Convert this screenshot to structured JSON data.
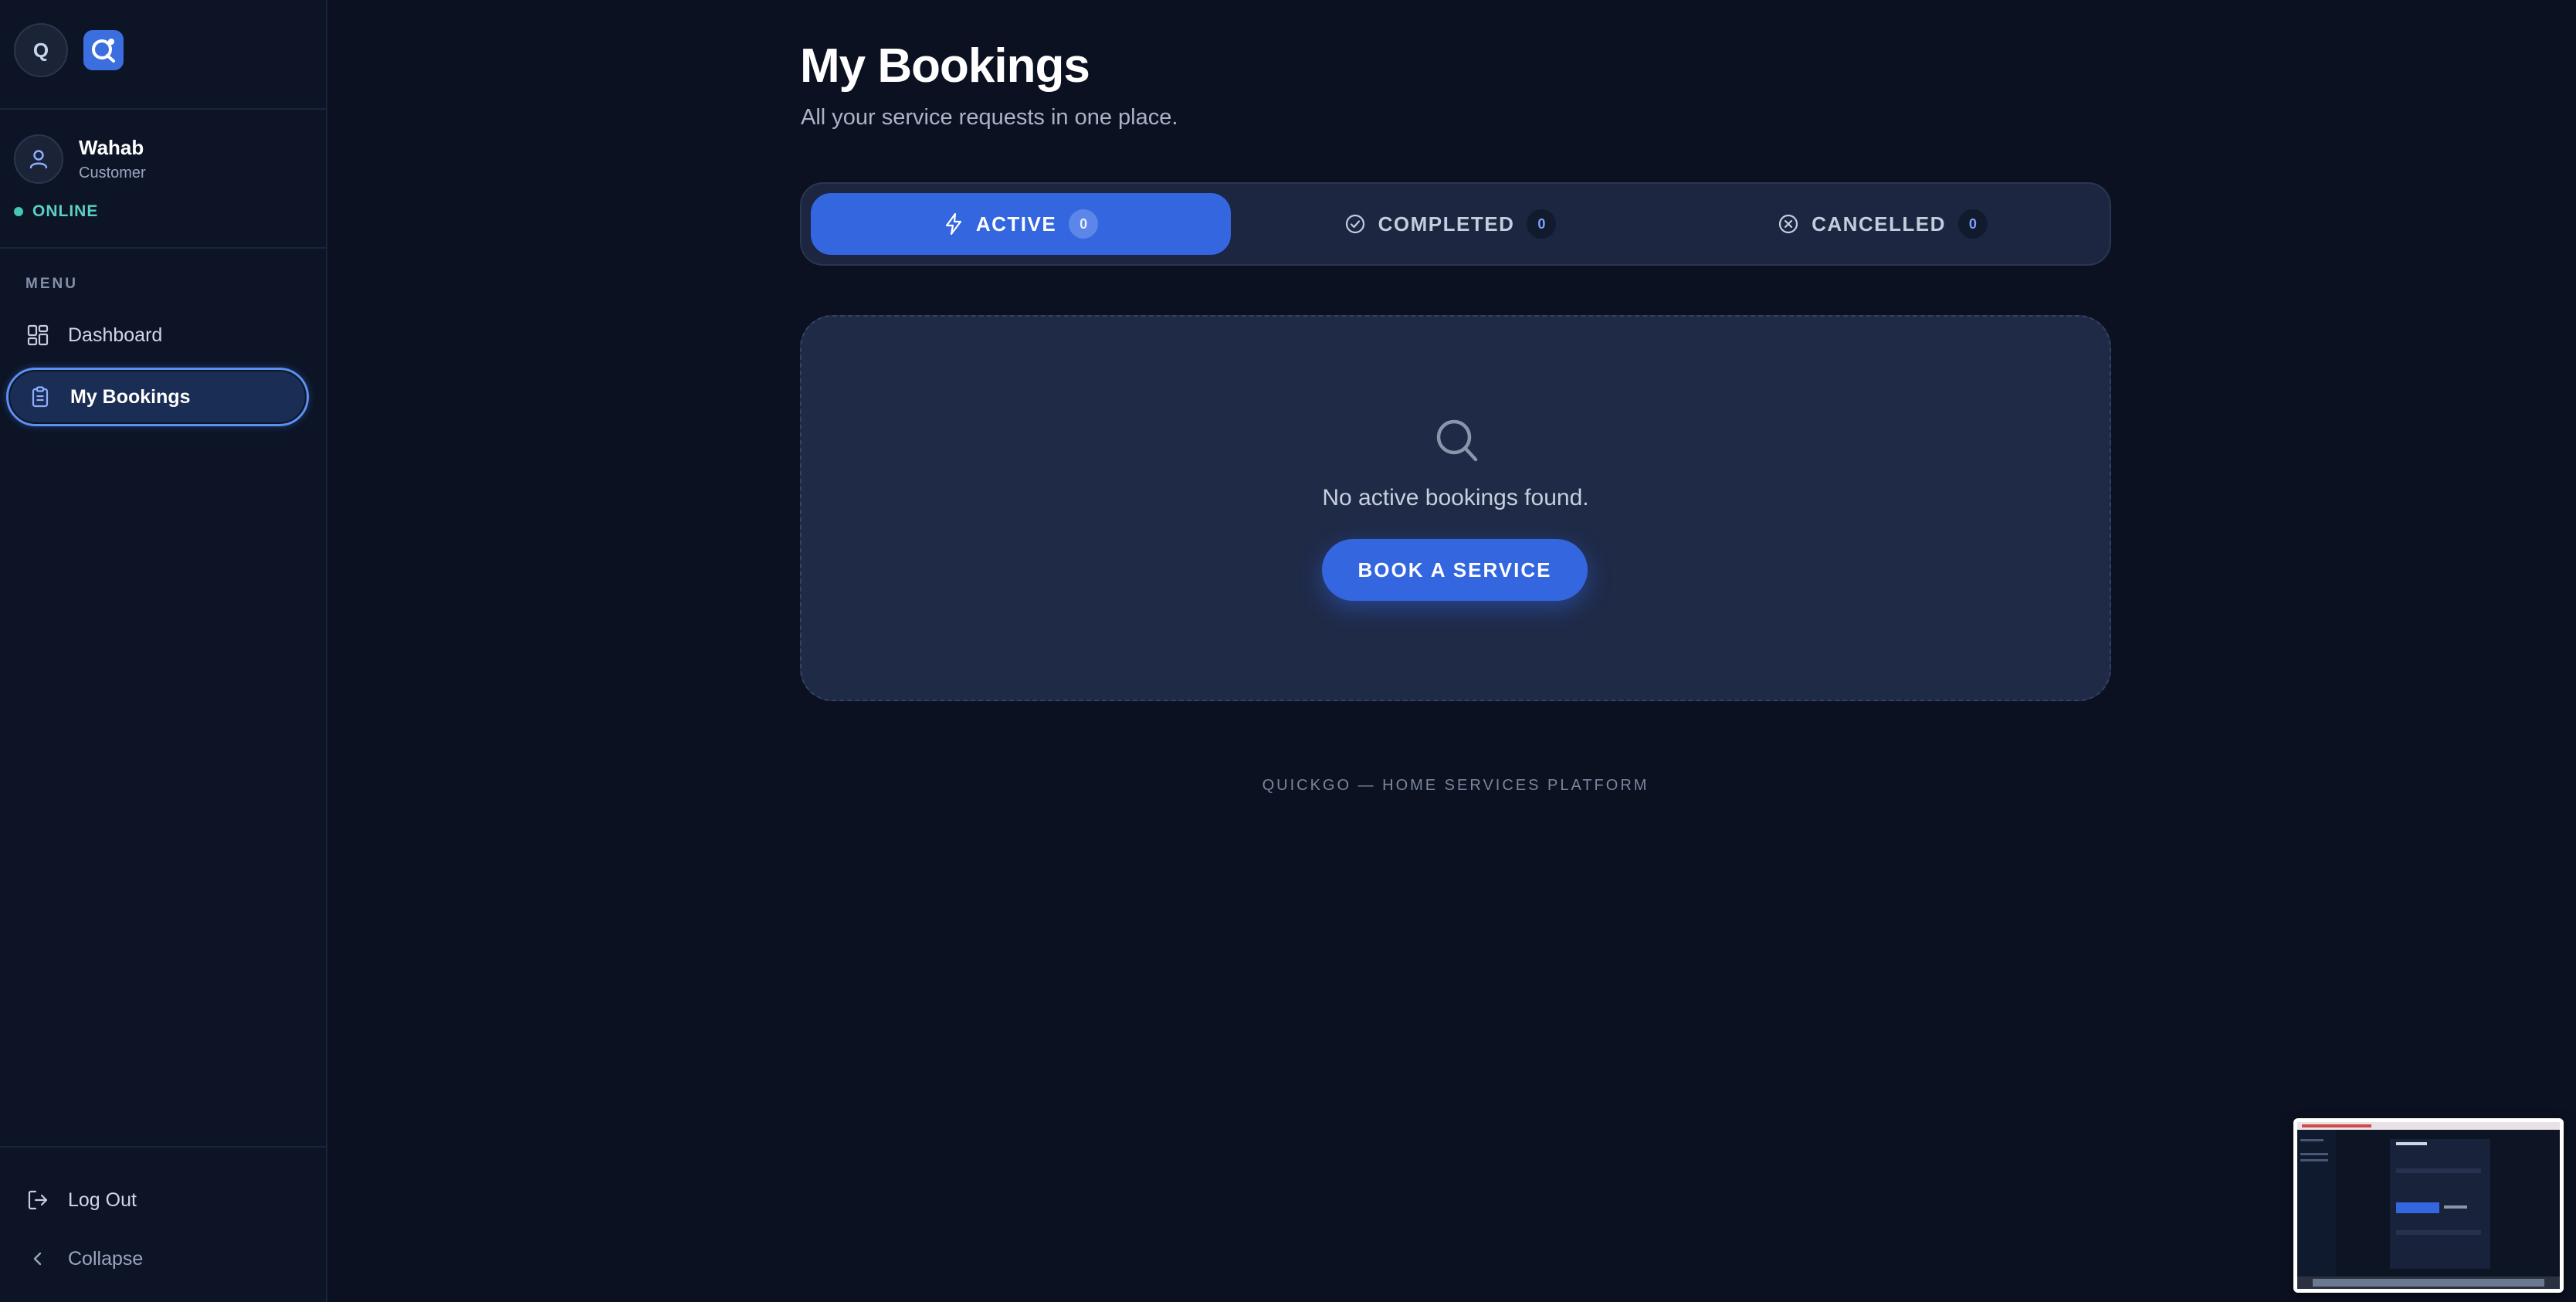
{
  "brand": {
    "badge_letter": "Q"
  },
  "user": {
    "name": "Wahab",
    "role": "Customer",
    "status": "ONLINE"
  },
  "sidebar": {
    "menu_label": "MENU",
    "items": [
      {
        "label": "Dashboard",
        "icon": "grid-icon"
      },
      {
        "label": "My Bookings",
        "icon": "clipboard-icon",
        "active": true
      }
    ],
    "logout_label": "Log Out",
    "collapse_label": "Collapse"
  },
  "page": {
    "title": "My Bookings",
    "subtitle": "All your service requests in one place."
  },
  "tabs": [
    {
      "label": "ACTIVE",
      "count": "0",
      "icon": "lightning-icon",
      "active": true
    },
    {
      "label": "COMPLETED",
      "count": "0",
      "icon": "check-circle-icon"
    },
    {
      "label": "CANCELLED",
      "count": "0",
      "icon": "x-circle-icon"
    }
  ],
  "empty_state": {
    "icon": "search-icon",
    "message": "No active bookings found.",
    "button_label": "BOOK A SERVICE"
  },
  "footer": {
    "text": "QUICKGO — HOME SERVICES PLATFORM"
  },
  "colors": {
    "background": "#0b1120",
    "sidebar": "#0c1426",
    "accent": "#3466e0",
    "online": "#46c6b4"
  }
}
